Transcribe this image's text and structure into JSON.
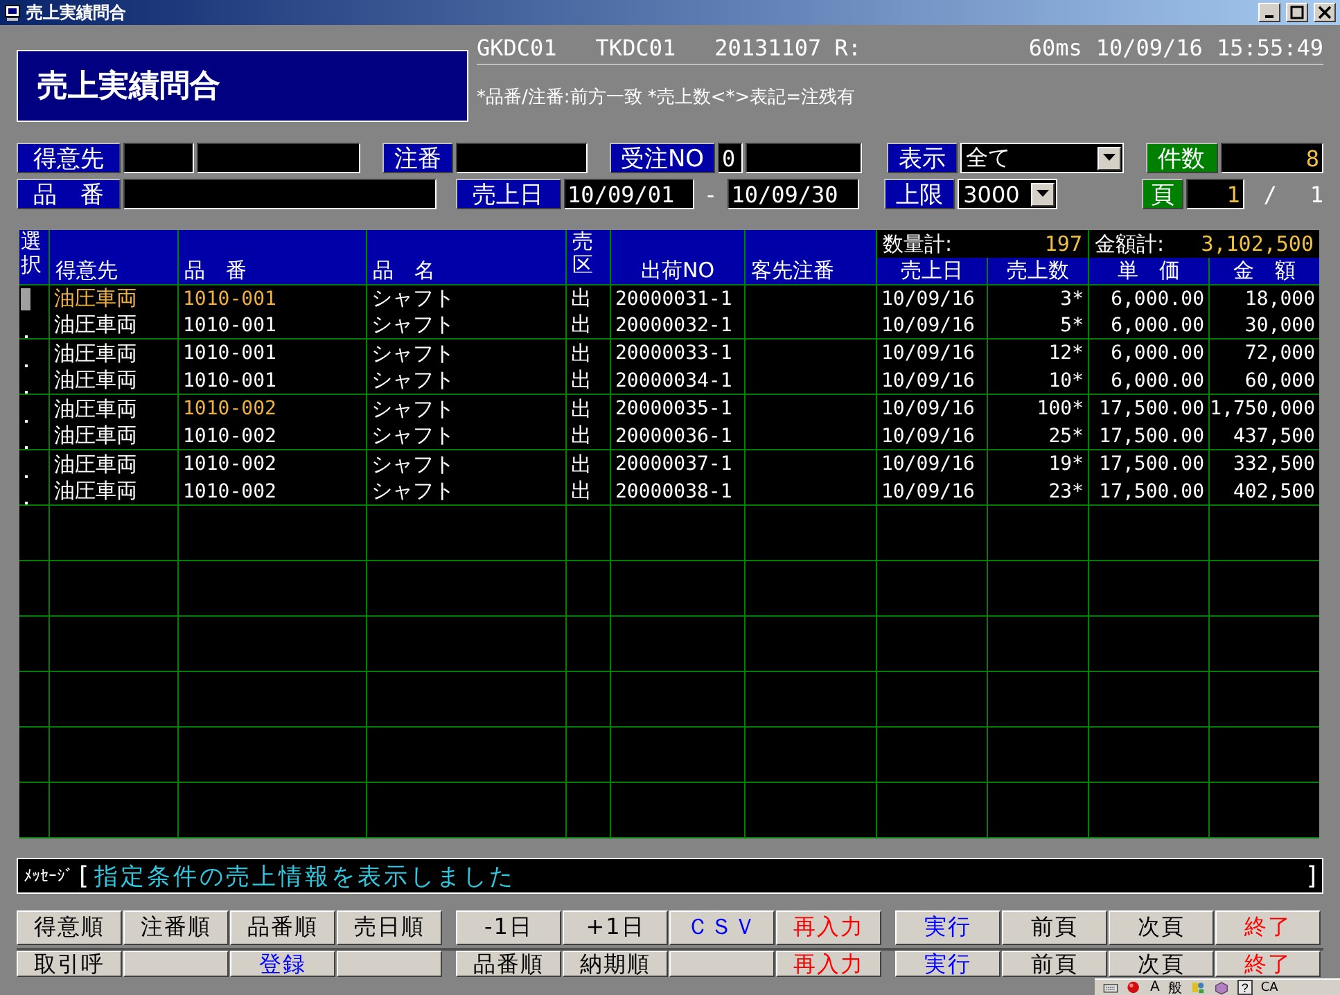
{
  "window": {
    "title": "売上実績問合"
  },
  "header": {
    "title": "売上実績問合",
    "status": [
      "GKDC01",
      "TKDC01",
      "20131107 R:",
      "60ms",
      "10/09/16",
      "15:55:49"
    ],
    "note": "*品番/注番:前方一致 *売上数<*>表記=注残有"
  },
  "filters": {
    "customer_label": "得意先",
    "order_label": "注番",
    "order_no_label": "受注NO",
    "order_no": "0",
    "display_label": "表示",
    "display": "全て",
    "count_label": "件数",
    "count": "8",
    "part_label": "品　番",
    "sales_date_label": "売上日",
    "date_from": "10/09/01",
    "date_sep": "-",
    "date_to": "10/09/30",
    "limit_label": "上限",
    "limit": "3000",
    "page_label": "頁",
    "page": "1",
    "page_sep": "/",
    "pages": "1"
  },
  "table": {
    "columns": [
      "選択",
      "得意先",
      "品　番",
      "品　名",
      "売区",
      "出荷NO",
      "客先注番",
      "売上日",
      "売上数",
      "単　価",
      "金　額"
    ],
    "totals": [
      {
        "label": "数量計:",
        "value": "197"
      },
      {
        "label": "金額計:",
        "value": "3,102,500"
      }
    ],
    "rows": [
      {
        "selected": true,
        "customer": "油圧車両",
        "customer_highlighted": true,
        "part": "1010-001",
        "part_highlighted": true,
        "name": "シャフト",
        "type": "出",
        "shipment_no": "20000031-1",
        "date": "10/09/16",
        "quantity": "3*",
        "unit_price": "6,000.00",
        "amount": "18,000"
      },
      {
        "selected": false,
        "customer": "油圧車両",
        "customer_highlighted": false,
        "part": "1010-001",
        "part_highlighted": false,
        "name": "シャフト",
        "type": "出",
        "shipment_no": "20000032-1",
        "date": "10/09/16",
        "quantity": "5*",
        "unit_price": "6,000.00",
        "amount": "30,000"
      },
      {
        "selected": false,
        "customer": "油圧車両",
        "customer_highlighted": false,
        "part": "1010-001",
        "part_highlighted": false,
        "name": "シャフト",
        "type": "出",
        "shipment_no": "20000033-1",
        "date": "10/09/16",
        "quantity": "12*",
        "unit_price": "6,000.00",
        "amount": "72,000"
      },
      {
        "selected": false,
        "customer": "油圧車両",
        "customer_highlighted": false,
        "part": "1010-001",
        "part_highlighted": false,
        "name": "シャフト",
        "type": "出",
        "shipment_no": "20000034-1",
        "date": "10/09/16",
        "quantity": "10*",
        "unit_price": "6,000.00",
        "amount": "60,000"
      },
      {
        "selected": false,
        "customer": "油圧車両",
        "customer_highlighted": false,
        "part": "1010-002",
        "part_highlighted": true,
        "name": "シャフト",
        "type": "出",
        "shipment_no": "20000035-1",
        "date": "10/09/16",
        "quantity": "100*",
        "unit_price": "17,500.00",
        "amount": "1,750,000"
      },
      {
        "selected": false,
        "customer": "油圧車両",
        "customer_highlighted": false,
        "part": "1010-002",
        "part_highlighted": false,
        "name": "シャフト",
        "type": "出",
        "shipment_no": "20000036-1",
        "date": "10/09/16",
        "quantity": "25*",
        "unit_price": "17,500.00",
        "amount": "437,500"
      },
      {
        "selected": false,
        "customer": "油圧車両",
        "customer_highlighted": false,
        "part": "1010-002",
        "part_highlighted": false,
        "name": "シャフト",
        "type": "出",
        "shipment_no": "20000037-1",
        "date": "10/09/16",
        "quantity": "19*",
        "unit_price": "17,500.00",
        "amount": "332,500"
      },
      {
        "selected": false,
        "customer": "油圧車両",
        "customer_highlighted": false,
        "part": "1010-002",
        "part_highlighted": false,
        "name": "シャフト",
        "type": "出",
        "shipment_no": "20000038-1",
        "date": "10/09/16",
        "quantity": "23*",
        "unit_price": "17,500.00",
        "amount": "402,500"
      }
    ]
  },
  "message": {
    "label": "ﾒｯｾｰｼﾞ",
    "open": "[",
    "text": "指定条件の売上情報を表示しました",
    "close": "]"
  },
  "buttons": [
    [
      [
        {
          "kind": "label",
          "label": "得意順"
        },
        {
          "kind": "label",
          "label": "注番順"
        },
        {
          "kind": "label",
          "label": "品番順"
        },
        {
          "kind": "label",
          "label": "売日順"
        }
      ],
      [
        {
          "kind": "label",
          "label": "-1日"
        },
        {
          "kind": "label",
          "label": "+1日"
        },
        {
          "kind": "label",
          "label": "ＣＳＶ",
          "color": "#0000ff"
        },
        {
          "kind": "label",
          "label": "再入力",
          "color": "#ff0000"
        }
      ],
      [
        {
          "kind": "label",
          "label": "実行",
          "color": "#0000ff"
        },
        {
          "kind": "label",
          "label": "前頁"
        },
        {
          "kind": "label",
          "label": "次頁"
        },
        {
          "kind": "label",
          "label": "終了",
          "color": "#ff0000"
        }
      ]
    ],
    [
      [
        {
          "kind": "label",
          "label": "取引呼"
        },
        {
          "kind": "blank"
        },
        {
          "kind": "label",
          "label": "登録",
          "color": "#0000ff"
        },
        {
          "kind": "blank"
        }
      ],
      [
        {
          "kind": "label",
          "label": "品番順"
        },
        {
          "kind": "label",
          "label": "納期順"
        },
        {
          "kind": "blank"
        },
        {
          "kind": "label",
          "label": "再入力",
          "color": "#ff0000"
        }
      ],
      [
        {
          "kind": "label",
          "label": "実行",
          "color": "#0000ff"
        },
        {
          "kind": "label",
          "label": "前頁"
        },
        {
          "kind": "label",
          "label": "次頁"
        },
        {
          "kind": "label",
          "label": "終了",
          "color": "#ff0000"
        }
      ]
    ]
  ],
  "ime_bar": {
    "mode": "A",
    "dictionary": "般",
    "help": "?",
    "edge": "CA"
  }
}
